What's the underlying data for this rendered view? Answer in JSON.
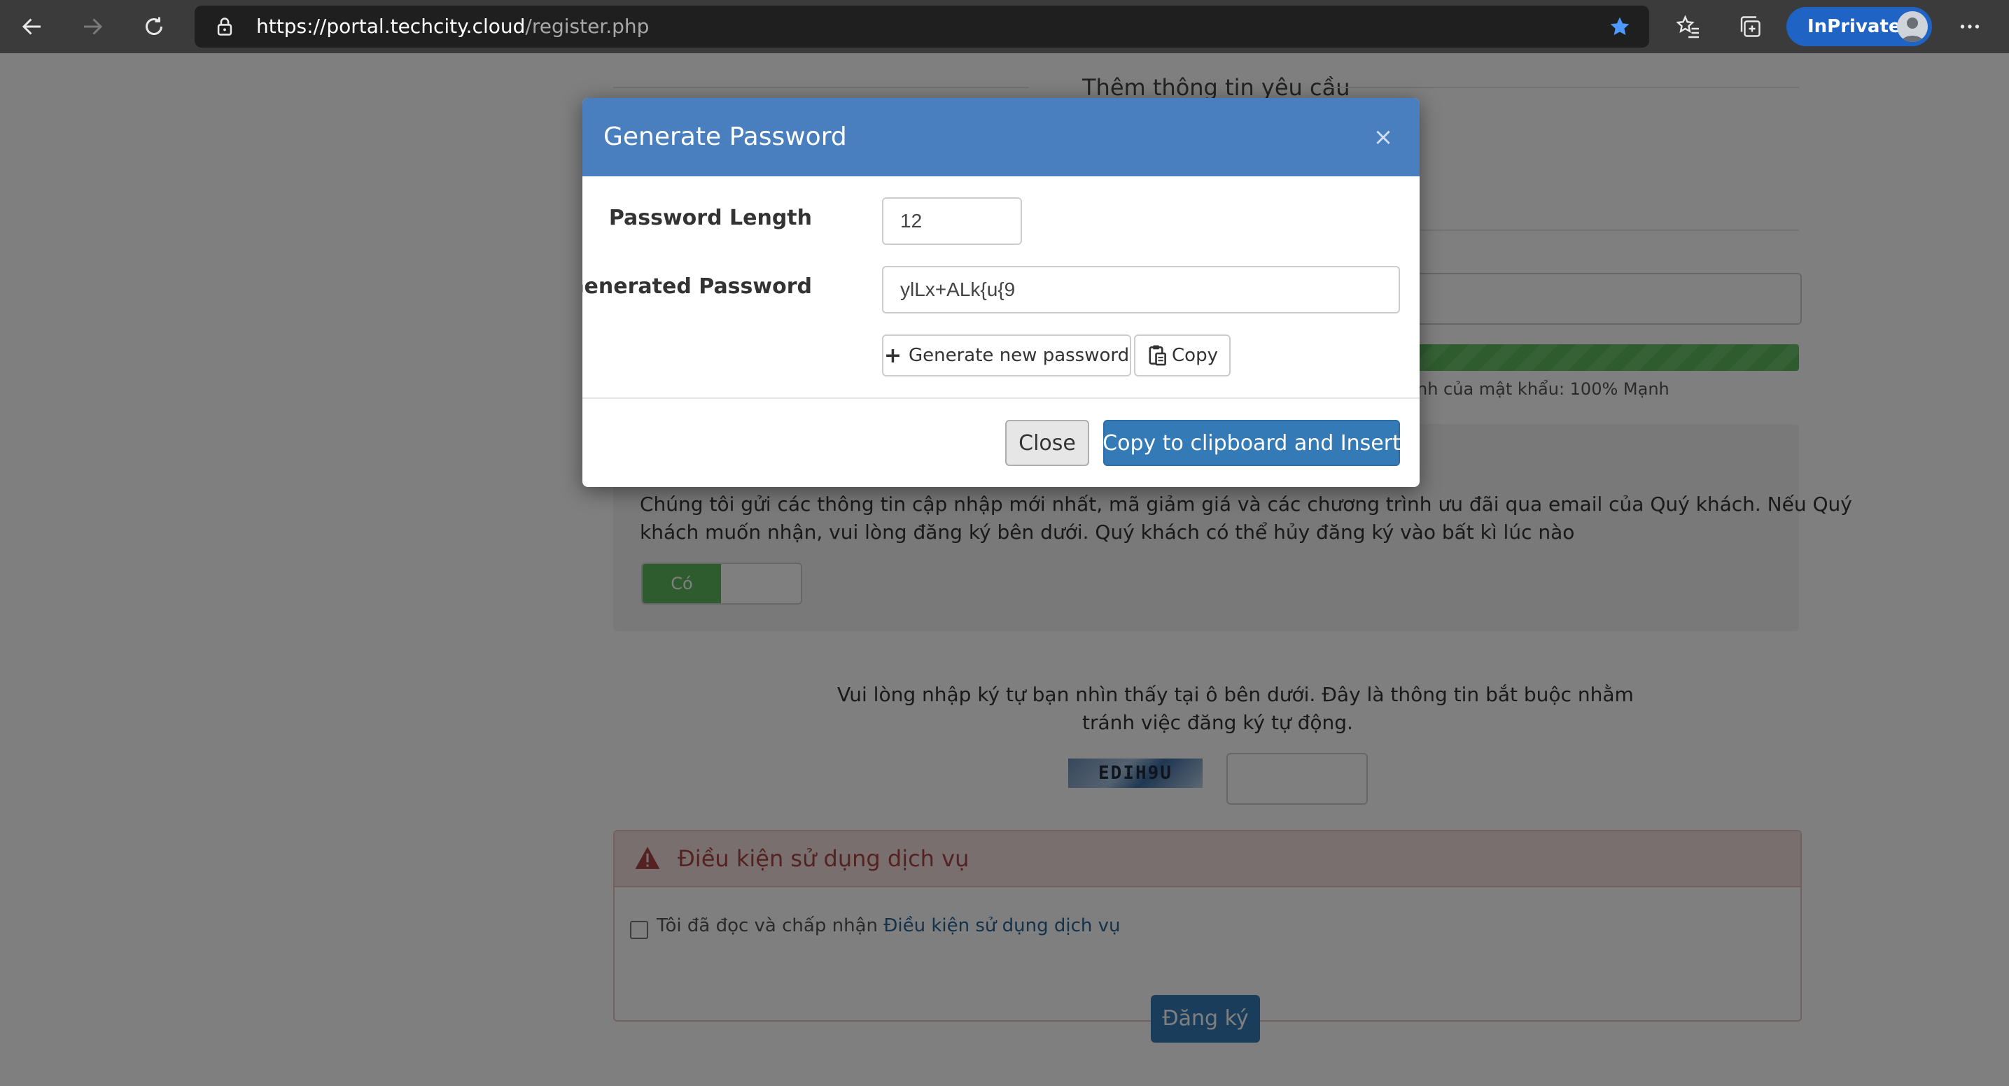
{
  "browser": {
    "url_host": "https://portal.techcity.cloud",
    "url_path": "/register.php",
    "inprivate_label": "InPrivate"
  },
  "background_page": {
    "section_heading": "Thêm thông tin yêu cầu",
    "password_strength_text": "nh của mật khẩu: 100% Mạnh",
    "password_strength_percent": 100,
    "newsletter_text_line1": "Chúng tôi gửi các thông tin cập nhập mới nhất, mã giảm giá và các chương trình ưu đãi qua email của Quý khách. Nếu Quý",
    "newsletter_text_line2": "khách muốn nhận, vui lòng đăng ký bên dưới. Quý khách có thể hủy đăng ký vào bất kì lúc nào",
    "newsletter_toggle_label": "Có",
    "captcha_instruction_line1": "Vui lòng nhập ký tự bạn nhìn thấy tại ô bên dưới. Đây là thông tin bắt buộc nhằm",
    "captcha_instruction_line2": "tránh việc đăng ký tự động.",
    "captcha_code": "EDIH9U",
    "tos_title": "Điều kiện sử dụng dịch vụ",
    "tos_checkbox_prefix": "Tôi đã đọc và chấp nhận ",
    "tos_checkbox_link": "Điều kiện sử dụng dịch vụ",
    "submit_label": "Đăng ký"
  },
  "modal": {
    "title": "Generate Password",
    "close_symbol": "×",
    "length_label": "Password Length",
    "length_value": "12",
    "generated_label": "Generated Password",
    "generated_value": "ylLx+ALk{u{9",
    "generate_button": "Generate new password",
    "copy_button": "Copy",
    "close_button": "Close",
    "insert_button": "Copy to clipboard and Insert"
  }
}
